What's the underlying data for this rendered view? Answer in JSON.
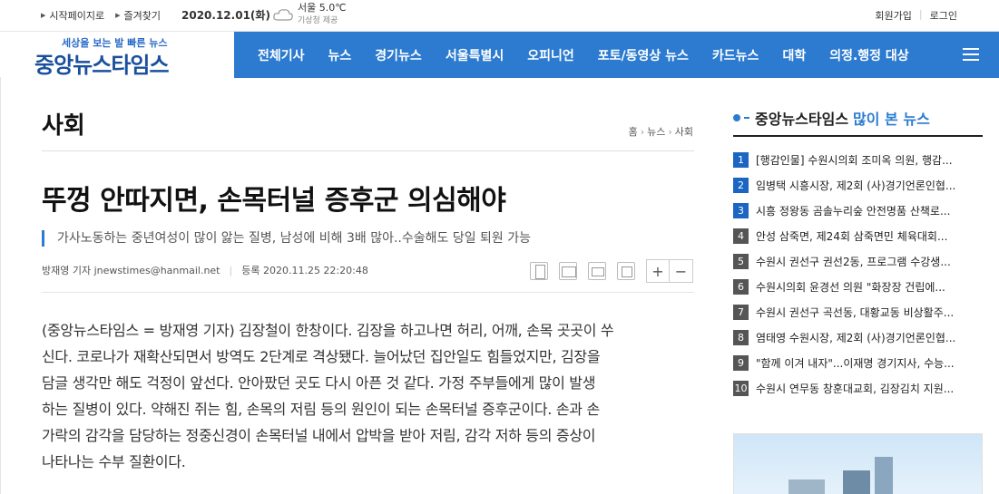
{
  "topbar": {
    "links": [
      "시작페이지로",
      "즐겨찾기"
    ],
    "date": "2020.12.01(화)",
    "weather": {
      "city_temp": "서울 5.0℃",
      "source": "기상청 제공"
    },
    "auth": [
      "회원가입",
      "로그인"
    ]
  },
  "logo": {
    "slogan": "세상을 보는 발 빠른 뉴스",
    "name": "중앙뉴스타임스"
  },
  "nav": {
    "items": [
      "전체기사",
      "뉴스",
      "경기뉴스",
      "서울특별시",
      "오피니언",
      "포토/동영상 뉴스",
      "카드뉴스",
      "대학",
      "의정.행정 대상"
    ]
  },
  "article": {
    "section": "사회",
    "breadcrumb": [
      "홈",
      "뉴스",
      "사회"
    ],
    "headline": "뚜껑 안따지면, 손목터널 증후군 의심해야",
    "subhead": "가사노동하는 중년여성이 많이 앓는 질병, 남성에 비해 3배 많아..수술해도 당일 퇴원 가능",
    "author": "방재영 기자 jnewstimes@hanmail.net",
    "date": "등록 2020.11.25  22:20:48",
    "zoom_in": "+",
    "zoom_out": "−",
    "body": [
      "(중앙뉴스타임스 = 방재영 기자) 김장철이 한창이다. 김장을 하고나면 허리, 어깨, 손목 곳곳이 쑤",
      "신다. 코로나가 재확산되면서 방역도 2단계로 격상됐다. 늘어났던 집안일도 힘들었지만, 김장을",
      "담글 생각만 해도 걱정이 앞선다. 안아팠던 곳도 다시 아픈 것 같다. 가정 주부들에게 많이 발생",
      "하는 질병이 있다. 약해진 쥐는 힘, 손목의 저림 등의 원인이 되는 손목터널 증후군이다. 손과 손",
      "가락의 감각을 담당하는 정중신경이 손목터널 내에서 압박을 받아 저림, 감각 저하 등의 증상이",
      "나타나는 수부 질환이다."
    ]
  },
  "popular": {
    "title_a": "중앙뉴스타임스",
    "title_b": "많이 본 뉴스",
    "items": [
      {
        "n": "1",
        "t": "[행감인물] 수원시의회 조미옥 의원, 행감..."
      },
      {
        "n": "2",
        "t": "임병택 시흥시장, 제2회 (사)경기언론인협..."
      },
      {
        "n": "3",
        "t": "시흥 정왕동 곰솔누리숲 안전명품 산책로..."
      },
      {
        "n": "4",
        "t": "안성 삼죽면, 제24회 삼죽면민 체육대회..."
      },
      {
        "n": "5",
        "t": "수원시 권선구 권선2동, 프로그램 수강생..."
      },
      {
        "n": "6",
        "t": "수원시의회 윤경선 의원 \"화장장 건립에..."
      },
      {
        "n": "7",
        "t": "수원시 권선구 곡선동, 대황교동 비상활주..."
      },
      {
        "n": "8",
        "t": "염태영 수원시장, 제2회 (사)경기언론인협..."
      },
      {
        "n": "9",
        "t": "\"함께 이겨 내자\"...이재명 경기지사, 수능..."
      },
      {
        "n": "10",
        "t": "수원시 연무동 창훈대교회, 김장김치 지원..."
      }
    ]
  }
}
